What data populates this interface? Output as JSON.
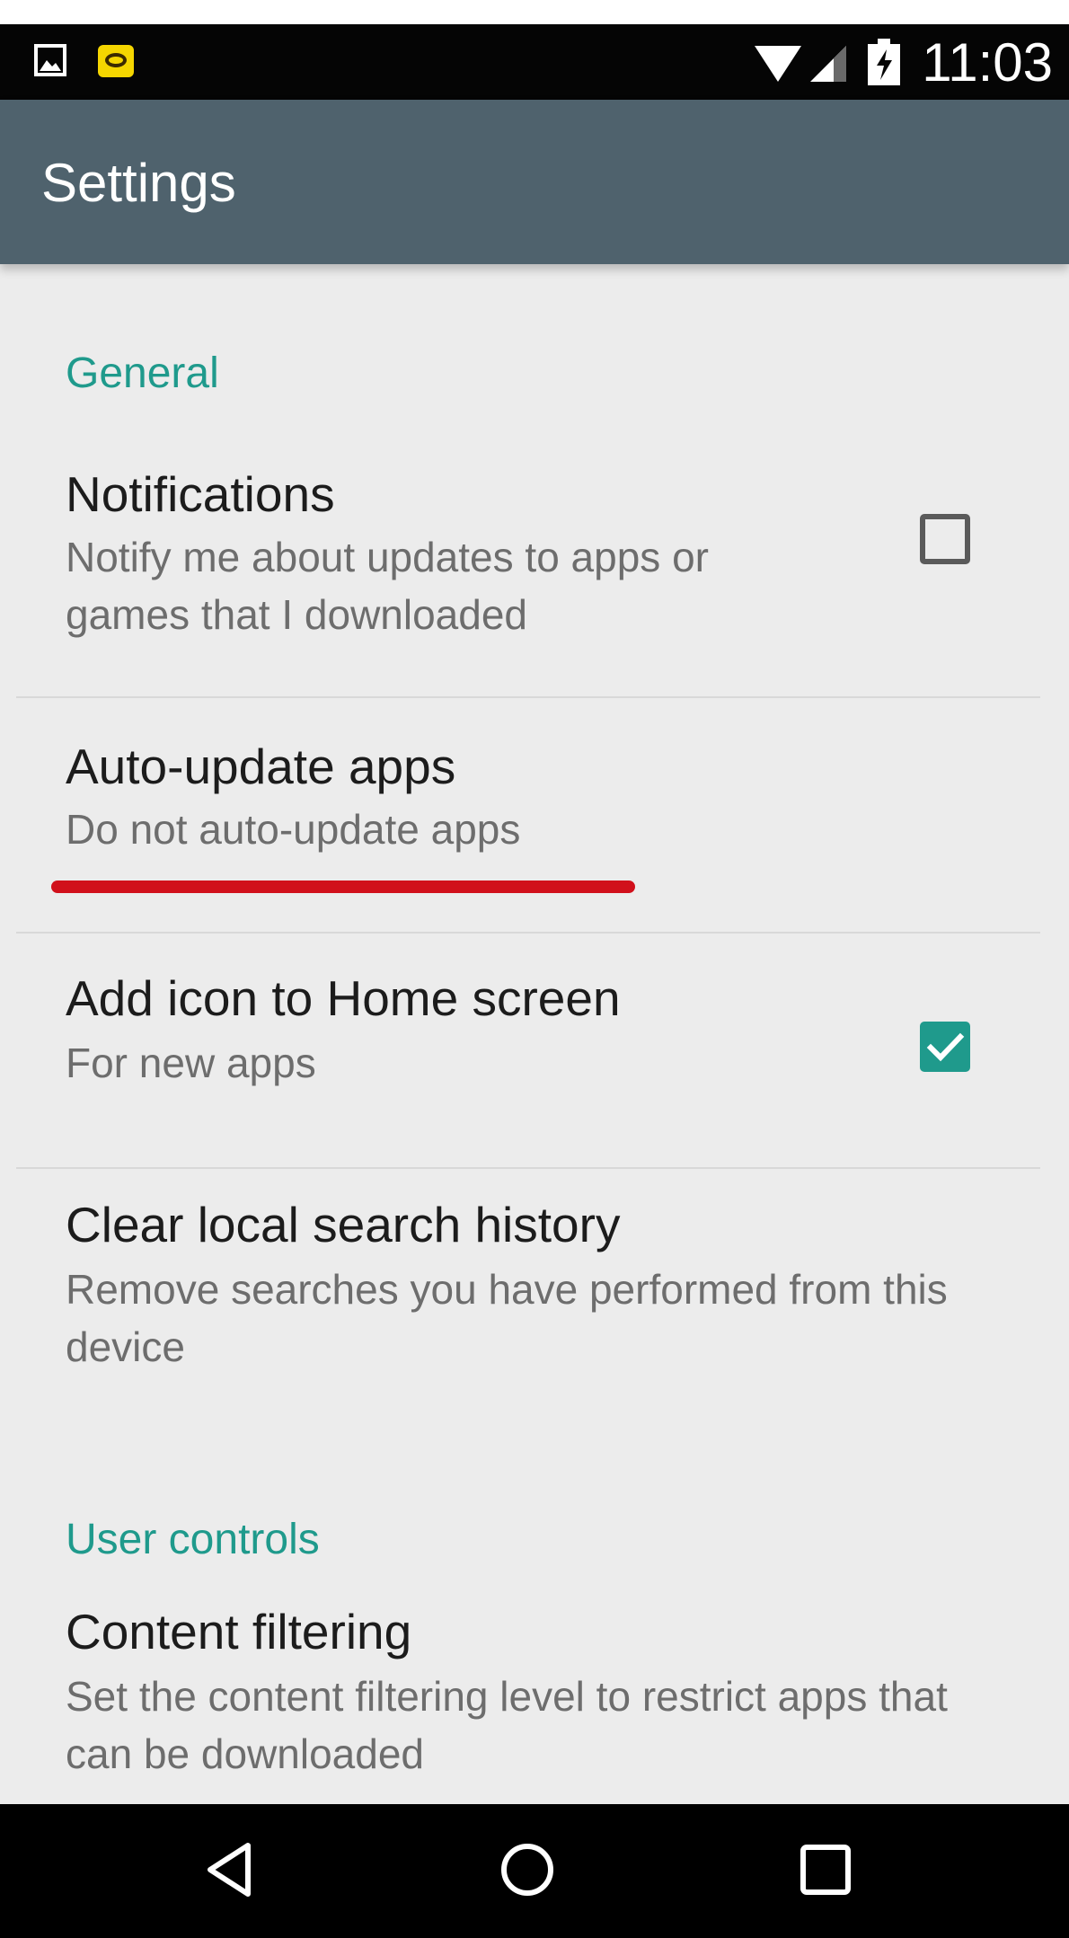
{
  "status_bar": {
    "time": "11:03",
    "icons": [
      "image-notification-icon",
      "chat-notification-icon",
      "wifi-icon",
      "cell-signal-icon",
      "battery-icon"
    ]
  },
  "app_bar": {
    "title": "Settings"
  },
  "sections": [
    {
      "header": "General",
      "items": [
        {
          "title": "Notifications",
          "summary": "Notify me about updates to apps or games that I downloaded",
          "checkbox": false
        },
        {
          "title": "Auto-update apps",
          "summary": "Do not auto-update apps"
        },
        {
          "title": "Add icon to Home screen",
          "summary": "For new apps",
          "checkbox": true
        },
        {
          "title": "Clear local search history",
          "summary": "Remove searches you have performed from this device"
        }
      ]
    },
    {
      "header": "User controls",
      "items": [
        {
          "title": "Content filtering",
          "summary": "Set the content filtering level to restrict apps that can be downloaded"
        }
      ]
    }
  ],
  "nav_bar": {
    "buttons": [
      "back-icon",
      "home-icon",
      "recents-icon"
    ]
  },
  "colors": {
    "status_bar_bg": "#050505",
    "app_bar_bg": "#4f626d",
    "content_bg": "#ececec",
    "accent": "#1f9a8c",
    "annotation_red": "#d1101b",
    "nav_bar_bg": "#000000"
  }
}
